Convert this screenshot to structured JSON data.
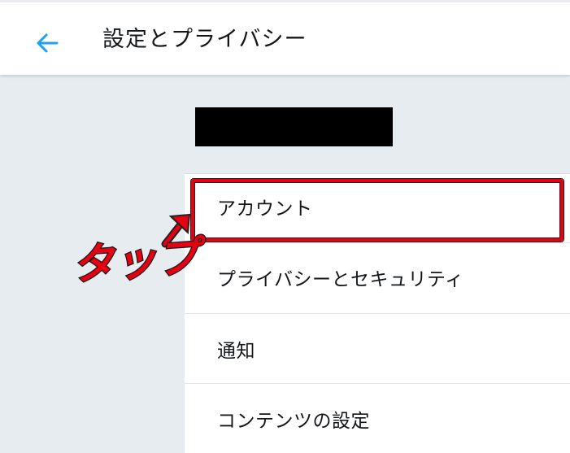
{
  "header": {
    "back_icon": "arrow-left-icon",
    "title": "設定とプライバシー",
    "accent_color": "#1da1f2"
  },
  "menu": {
    "items": [
      {
        "label": "アカウント"
      },
      {
        "label": "プライバシーとセキュリティ"
      },
      {
        "label": "通知"
      },
      {
        "label": "コンテンツの設定"
      }
    ]
  },
  "annotation": {
    "text": "タップ",
    "color": "#e60012"
  }
}
